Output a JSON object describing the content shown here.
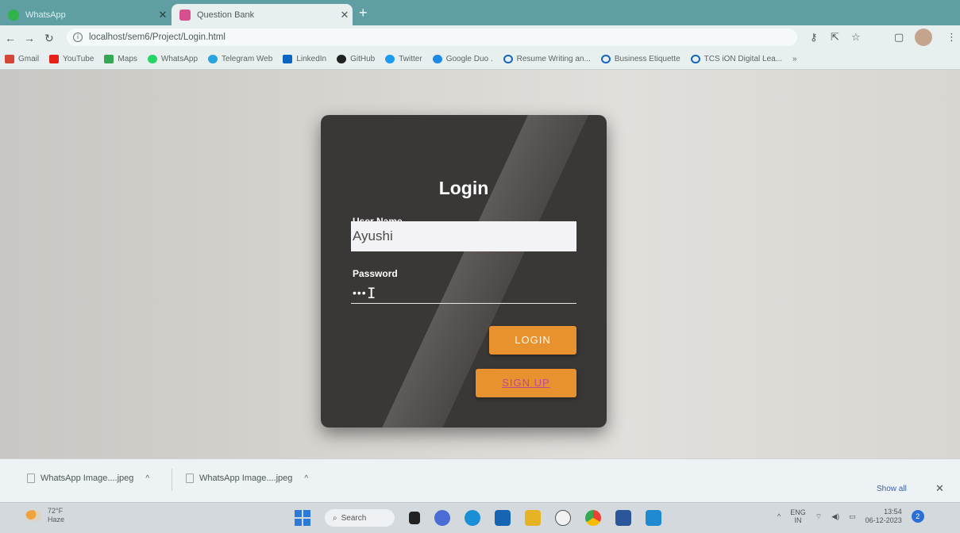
{
  "browser": {
    "tabs": [
      {
        "title": "WhatsApp",
        "icon": "whatsapp-icon",
        "color": "#30b34a"
      },
      {
        "title": "Question Bank",
        "icon": "page-icon",
        "color": "#d64f8f"
      }
    ],
    "url": "localhost/sem6/Project/Login.html",
    "bookmarks": [
      {
        "label": "Gmail",
        "color": "#d44638"
      },
      {
        "label": "YouTube",
        "color": "#e62117"
      },
      {
        "label": "Maps",
        "color": "#34a853"
      },
      {
        "label": "WhatsApp",
        "color": "#25d366"
      },
      {
        "label": "Telegram Web",
        "color": "#2aa3de"
      },
      {
        "label": "LinkedIn",
        "color": "#0a66c2"
      },
      {
        "label": "GitHub",
        "color": "#222222"
      },
      {
        "label": "Twitter",
        "color": "#1d9bf0"
      },
      {
        "label": "Google Duo .",
        "color": "#1e88e5"
      },
      {
        "label": "Resume Writing an...",
        "color": "#1565c0"
      },
      {
        "label": "Business Etiquette",
        "color": "#1565c0"
      },
      {
        "label": "TCS iON Digital Lea...",
        "color": "#1565c0"
      }
    ]
  },
  "login": {
    "title": "Login",
    "username_label": "User Name",
    "username_value": "Ayushi",
    "password_label": "Password",
    "password_value": "•••",
    "login_button": "LOGIN",
    "signup_button": "SIGN UP"
  },
  "downloads": {
    "items": [
      "WhatsApp Image....jpeg",
      "WhatsApp Image....jpeg"
    ],
    "show_all": "Show all"
  },
  "taskbar": {
    "weather_temp": "72°F",
    "weather_desc": "Haze",
    "search_label": "Search",
    "language": "ENG",
    "region": "IN",
    "time": "13:54",
    "date": "06-12-2023",
    "notification_count": "2"
  }
}
